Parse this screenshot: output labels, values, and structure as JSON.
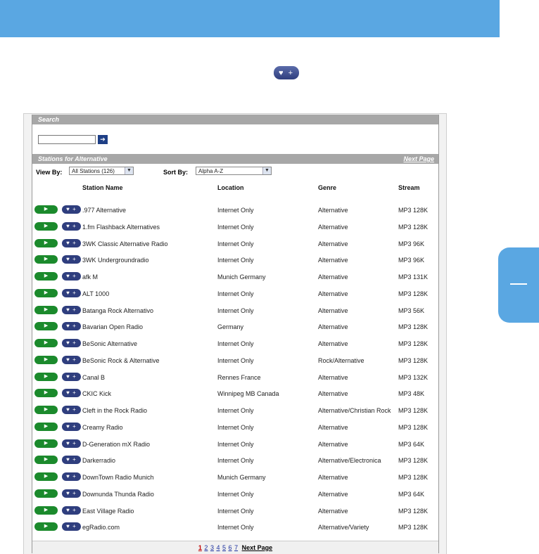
{
  "favorite_button": {
    "label": "♥ +"
  },
  "play_button": {
    "label": "▶"
  },
  "search": {
    "title": "Search",
    "go_label": "➔"
  },
  "stations": {
    "title": "Stations for Alternative",
    "next_page_label": "Next Page",
    "view_by_label": "View By:",
    "view_by_value": "All Stations (126)",
    "sort_by_label": "Sort By:",
    "sort_by_value": "Alpha A-Z",
    "columns": [
      "Station Name",
      "Location",
      "Genre",
      "Stream"
    ],
    "rows": [
      {
        "name": ".977 Alternative",
        "location": "Internet Only",
        "genre": "Alternative",
        "stream": "MP3 128K"
      },
      {
        "name": "1.fm Flashback Alternatives",
        "location": "Internet Only",
        "genre": "Alternative",
        "stream": "MP3 128K"
      },
      {
        "name": "3WK Classic Alternative Radio",
        "location": "Internet Only",
        "genre": "Alternative",
        "stream": "MP3 96K"
      },
      {
        "name": "3WK Undergroundradio",
        "location": "Internet Only",
        "genre": "Alternative",
        "stream": "MP3 96K"
      },
      {
        "name": "afk M",
        "location": "Munich Germany",
        "genre": "Alternative",
        "stream": "MP3 131K"
      },
      {
        "name": "ALT 1000",
        "location": "Internet Only",
        "genre": "Alternative",
        "stream": "MP3 128K"
      },
      {
        "name": "Batanga Rock Alternativo",
        "location": "Internet Only",
        "genre": "Alternative",
        "stream": "MP3 56K"
      },
      {
        "name": "Bavarian Open Radio",
        "location": "Germany",
        "genre": "Alternative",
        "stream": "MP3 128K"
      },
      {
        "name": "BeSonic Alternative",
        "location": "Internet Only",
        "genre": "Alternative",
        "stream": "MP3 128K"
      },
      {
        "name": "BeSonic Rock & Alternative",
        "location": "Internet Only",
        "genre": "Rock/Alternative",
        "stream": "MP3 128K"
      },
      {
        "name": "Canal B",
        "location": "Rennes France",
        "genre": "Alternative",
        "stream": "MP3 132K"
      },
      {
        "name": "CKIC Kick",
        "location": "Winnipeg MB Canada",
        "genre": "Alternative",
        "stream": "MP3 48K"
      },
      {
        "name": "Cleft in the Rock Radio",
        "location": "Internet Only",
        "genre": "Alternative/Christian Rock",
        "stream": "MP3 128K"
      },
      {
        "name": "Creamy Radio",
        "location": "Internet Only",
        "genre": "Alternative",
        "stream": "MP3 128K"
      },
      {
        "name": "D-Generation mX Radio",
        "location": "Internet Only",
        "genre": "Alternative",
        "stream": "MP3 64K"
      },
      {
        "name": "Darkerradio",
        "location": "Internet Only",
        "genre": "Alternative/Electronica",
        "stream": "MP3 128K"
      },
      {
        "name": "DownTown Radio Munich",
        "location": "Munich Germany",
        "genre": "Alternative",
        "stream": "MP3 128K"
      },
      {
        "name": "Downunda Thunda Radio",
        "location": "Internet Only",
        "genre": "Alternative",
        "stream": "MP3 64K"
      },
      {
        "name": "East Village Radio",
        "location": "Internet Only",
        "genre": "Alternative",
        "stream": "MP3 128K"
      },
      {
        "name": "egRadio.com",
        "location": "Internet Only",
        "genre": "Alternative/Variety",
        "stream": "MP3 128K"
      }
    ]
  },
  "pager": {
    "current": "1",
    "pages": [
      "2",
      "3",
      "4",
      "5",
      "6",
      "7"
    ],
    "next_label": "Next Page"
  },
  "colors": {
    "banner": "#5aa7e2",
    "header_bar": "#a7a7a7",
    "play_green": "#1b8a2c",
    "favorite_navy": "#2f3e7e"
  }
}
